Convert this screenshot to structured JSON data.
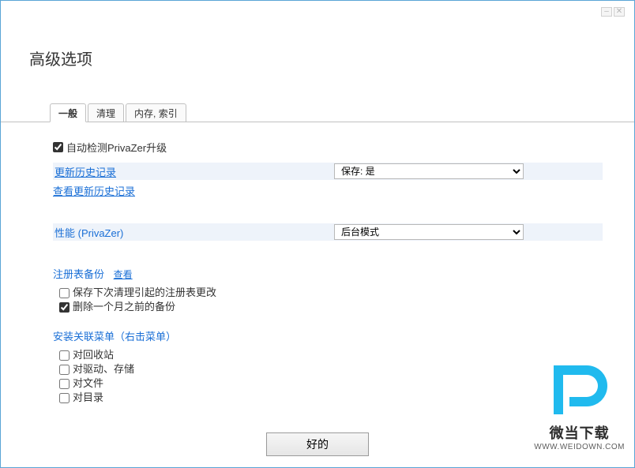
{
  "title": "高级选项",
  "tabs": {
    "general": "一般",
    "clean": "清理",
    "mem_index": "内存, 索引"
  },
  "auto_detect": {
    "label": "自动检测PrivaZer升级",
    "checked": true
  },
  "update_history": {
    "heading": "更新历史记录",
    "view_label": "查看更新历史记录",
    "select_value": "保存: 是"
  },
  "performance": {
    "heading": "性能 (PrivaZer)",
    "select_value": "后台模式"
  },
  "registry_backup": {
    "heading": "注册表备份",
    "view_label": "查看",
    "opt1": {
      "label": "保存下次清理引起的注册表更改",
      "checked": false
    },
    "opt2": {
      "label": "删除一个月之前的备份",
      "checked": true
    }
  },
  "context_menu": {
    "heading": "安装关联菜单（右击菜单）",
    "opt1": {
      "label": "对回收站",
      "checked": false
    },
    "opt2": {
      "label": "对驱动、存储",
      "checked": false
    },
    "opt3": {
      "label": "对文件",
      "checked": false
    },
    "opt4": {
      "label": "对目录",
      "checked": false
    }
  },
  "ok_button": "好的",
  "watermark": {
    "cn": "微当下载",
    "en": "WWW.WEIDOWN.COM"
  }
}
